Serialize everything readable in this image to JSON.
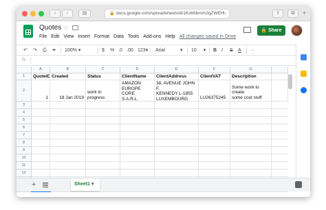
{
  "browser": {
    "url": "docs.google.com/spreadsheets/d/1Kvb5bmm2qZWEH",
    "reload_icon": "reload-icon",
    "lock_icon": "lock-icon"
  },
  "app": {
    "doc_title": "Quotes",
    "menu": [
      "File",
      "Edit",
      "View",
      "Insert",
      "Format",
      "Data",
      "Tools",
      "Add-ons",
      "Help"
    ],
    "save_status": "All changes saved in Drive",
    "share_label": "Share",
    "accent": "#188038"
  },
  "toolbar": {
    "zoom": "100%",
    "currency": "$",
    "percent": "%",
    "decimal_less": ".0",
    "decimal_more": ".00",
    "number_format": "123",
    "font": "Arial",
    "font_size": "10",
    "bold": "B",
    "italic": "I",
    "strike": "S",
    "text_color": "A",
    "more": "···"
  },
  "formula_bar": {
    "fx": "fx"
  },
  "grid": {
    "columns": [
      "A",
      "B",
      "C",
      "D",
      "E",
      "F",
      "G"
    ],
    "rows": [
      "1",
      "2",
      "3",
      "4",
      "5",
      "6",
      "7",
      "8",
      "9",
      "10",
      "11",
      "12",
      "13",
      "14"
    ],
    "header_row": [
      "QuoteID",
      "Created",
      "Status",
      "ClientName",
      "ClientAddress",
      "ClientVAT",
      "Description"
    ],
    "data_row": {
      "quote_id": "1",
      "created": "18 Jan 2019",
      "status": "work in progress",
      "client_name": [
        "AMAZON",
        "EUROPE CORE",
        "S.A.R.L."
      ],
      "client_address": [
        "38, AVENUE JOHN F.",
        "KENNEDY L-1855",
        "LUXEMBOURG"
      ],
      "client_vat": "LU26375245",
      "description": [
        "Some work to create",
        "some cool stuff"
      ]
    }
  },
  "sheets": [
    {
      "label": "Sheet1",
      "active": true
    }
  ]
}
